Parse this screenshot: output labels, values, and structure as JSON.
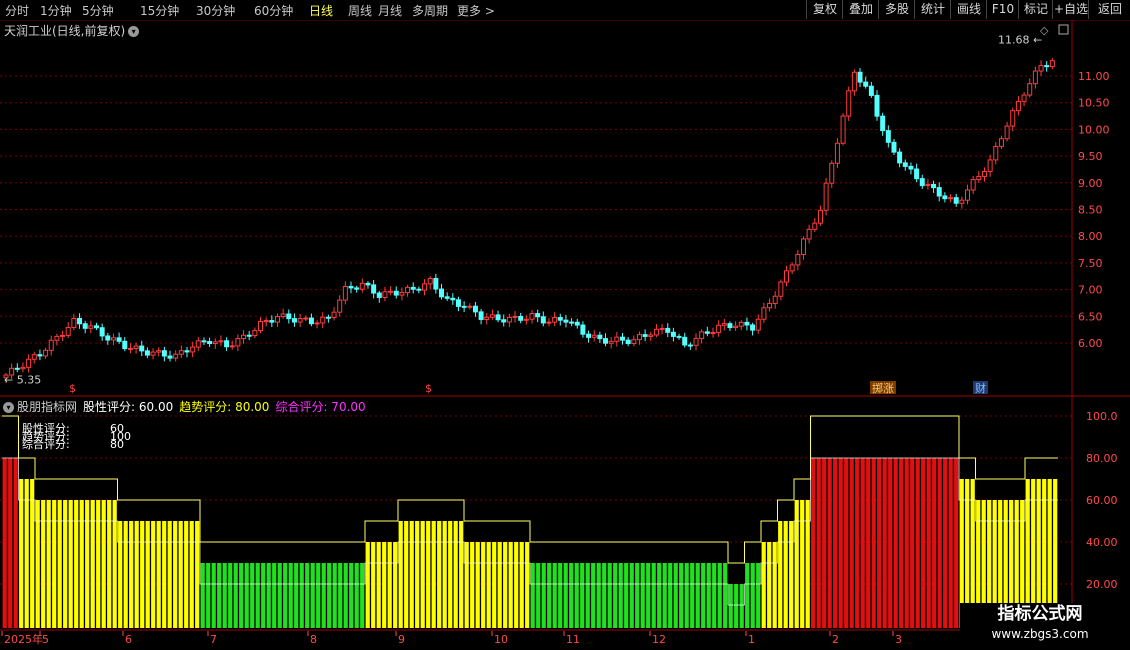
{
  "toolbar": {
    "timeframes": [
      "分时",
      "1分钟",
      "5分钟",
      "15分钟",
      "30分钟",
      "60分钟",
      "日线",
      "周线",
      "月线",
      "多周期",
      "更多 >"
    ],
    "active_index": 6,
    "right_buttons": [
      "复权",
      "叠加",
      "多股",
      "统计",
      "画线",
      "F10",
      "+自选",
      "返回"
    ],
    "mark_label": "标记"
  },
  "main_chart": {
    "title": "天润工业(日线,前复权)",
    "price_axis": [
      "11.00",
      "10.50",
      "10.00",
      "9.50",
      "9.00",
      "8.50",
      "8.00",
      "7.50",
      "7.00",
      "6.50",
      "6.00"
    ],
    "high_label": "11.68",
    "low_label": "5.35",
    "markers": [
      "$",
      "$",
      "掷涨",
      "财"
    ]
  },
  "indicator": {
    "title": "股朋指标网",
    "stock_score": "股性评分: 60.00",
    "trend_score": "趋势评分: 80.00",
    "combined_score": "综合评分: 70.00",
    "table_labels": [
      "股性评分:",
      "趋势评分:",
      "综合评分:"
    ],
    "table_values": [
      "60",
      "100",
      "80"
    ],
    "axis": [
      "100.0",
      "80.00",
      "60.00",
      "40.00",
      "20.00"
    ]
  },
  "date_axis": [
    "2025年",
    "5",
    "6",
    "7",
    "8",
    "9",
    "10",
    "11",
    "12",
    "1",
    "2",
    "3"
  ],
  "watermark": {
    "line1": "指标公式网",
    "line2": "www.zbgs3.com"
  },
  "colors": {
    "up": "#ff3c3c",
    "down": "#54ffff",
    "yellow": "#ffff00",
    "green": "#20e020",
    "red": "#e01010",
    "magenta": "#ff00ff",
    "grid": "#7a0000"
  },
  "chart_data": [
    {
      "type": "candlestick",
      "title": "天润工业(日线,前复权)",
      "ylim": [
        5.2,
        11.9
      ],
      "x": [
        "2025年",
        "5",
        "6",
        "7",
        "8",
        "9",
        "10",
        "11",
        "12",
        "1",
        "2",
        "3"
      ],
      "close": [
        5.4,
        5.6,
        5.8,
        6.1,
        6.4,
        6.3,
        6.1,
        5.95,
        5.85,
        5.8,
        5.75,
        5.95,
        6.05,
        5.95,
        6.1,
        6.35,
        6.5,
        6.45,
        6.4,
        6.45,
        7.0,
        7.1,
        6.9,
        6.95,
        7.0,
        7.15,
        6.8,
        6.7,
        6.5,
        6.45,
        6.45,
        6.5,
        6.4,
        6.45,
        6.2,
        6.05,
        6.05,
        6.05,
        6.2,
        6.25,
        5.95,
        6.15,
        6.3,
        6.35,
        6.3,
        6.75,
        7.3,
        7.9,
        8.5,
        9.8,
        11.1,
        10.6,
        9.7,
        9.3,
        9.0,
        8.8,
        8.6,
        9.0,
        9.4,
        10.1,
        10.7,
        11.2,
        11.3
      ]
    },
    {
      "type": "bar",
      "title": "股朋指标网",
      "ylim": [
        0,
        105
      ],
      "values": [
        80,
        70,
        60,
        60,
        60,
        60,
        60,
        50,
        50,
        50,
        50,
        50,
        30,
        30,
        30,
        30,
        30,
        30,
        30,
        30,
        30,
        30,
        40,
        40,
        50,
        50,
        50,
        50,
        40,
        40,
        40,
        40,
        30,
        30,
        30,
        30,
        30,
        30,
        30,
        30,
        30,
        30,
        30,
        30,
        20,
        30,
        40,
        50,
        60,
        80,
        80,
        80,
        80,
        80,
        80,
        80,
        80,
        80,
        70,
        60,
        60,
        60,
        70,
        70
      ]
    }
  ]
}
